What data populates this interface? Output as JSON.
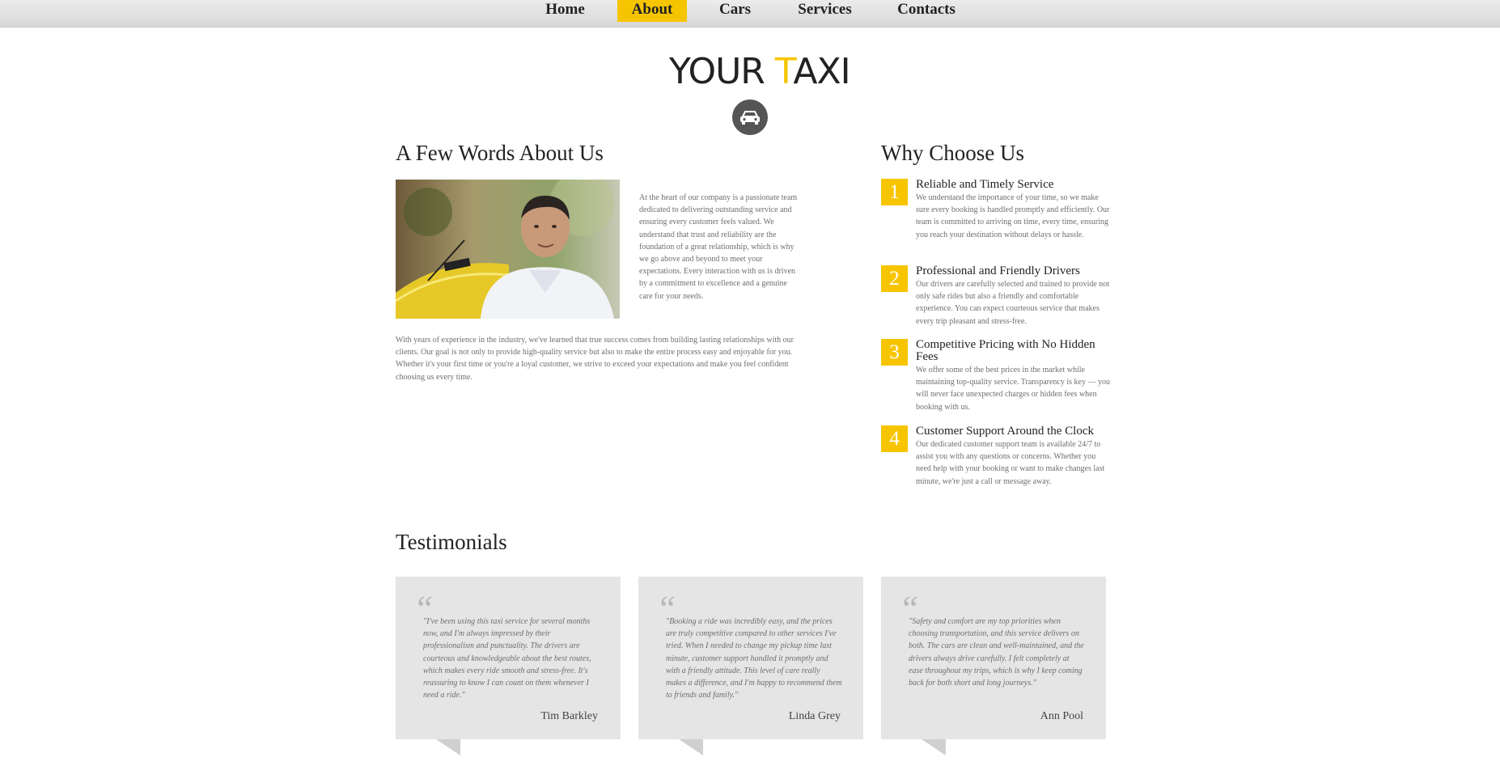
{
  "nav": {
    "items": [
      "Home",
      "About",
      "Cars",
      "Services",
      "Contacts"
    ],
    "active": "About"
  },
  "logo": {
    "part1": "YOUR ",
    "accent": "T",
    "part2": "AXI"
  },
  "about": {
    "heading": "A Few Words About Us",
    "para1": "At the heart of our company is a passionate team dedicated to delivering outstanding service and ensuring every customer feels valued. We understand that trust and reliability are the foundation of a great relationship, which is why we go above and beyond to meet your expectations. Every interaction with us is driven by a commitment to excellence and a genuine care for your needs.",
    "para2": "With years of experience in the industry, we've learned that true success comes from building lasting relationships with our clients. Our goal is not only to provide high-quality service but also to make the entire process easy and enjoyable for you. Whether it's your first time or you're a loyal customer, we strive to exceed your expectations and make you feel confident choosing us every time."
  },
  "why": {
    "heading": "Why Choose Us",
    "items": [
      {
        "num": "1",
        "title": "Reliable and Timely Service",
        "text": "We understand the importance of your time, so we make sure every booking is handled promptly and efficiently. Our team is committed to arriving on time, every time, ensuring you reach your destination without delays or hassle."
      },
      {
        "num": "2",
        "title": "Professional and Friendly Drivers",
        "text": "Our drivers are carefully selected and trained to provide not only safe rides but also a friendly and comfortable experience. You can expect courteous service that makes every trip pleasant and stress-free."
      },
      {
        "num": "3",
        "title": "Competitive Pricing with No Hidden Fees",
        "text": "We offer some of the best prices in the market while maintaining top-quality service. Transparency is key — you will never face unexpected charges or hidden fees when booking with us."
      },
      {
        "num": "4",
        "title": "Customer Support Around the Clock",
        "text": "Our dedicated customer support team is available 24/7 to assist you with any questions or concerns. Whether you need help with your booking or want to make changes last minute, we're just a call or message away."
      }
    ]
  },
  "testimonials": {
    "heading": "Testimonials",
    "items": [
      {
        "quote": "\"I've been using this taxi service for several months now, and I'm always impressed by their professionalism and punctuality. The drivers are courteous and knowledgeable about the best routes, which makes every ride smooth and stress-free. It's reassuring to know I can count on them whenever I need a ride.\"",
        "author": "Tim Barkley"
      },
      {
        "quote": "\"Booking a ride was incredibly easy, and the prices are truly competitive compared to other services I've tried. When I needed to change my pickup time last minute, customer support handled it promptly and with a friendly attitude. This level of care really makes a difference, and I'm happy to recommend them to friends and family.\"",
        "author": "Linda Grey"
      },
      {
        "quote": "\"Safety and comfort are my top priorities when choosing transportation, and this service delivers on both. The cars are clean and well-maintained, and the drivers always drive carefully. I felt completely at ease throughout my trips, which is why I keep coming back for both short and long journeys.\"",
        "author": "Ann Pool"
      }
    ]
  },
  "colors": {
    "accent": "#f7c500",
    "card": "#e5e5e6",
    "text": "#6e6e6e"
  }
}
